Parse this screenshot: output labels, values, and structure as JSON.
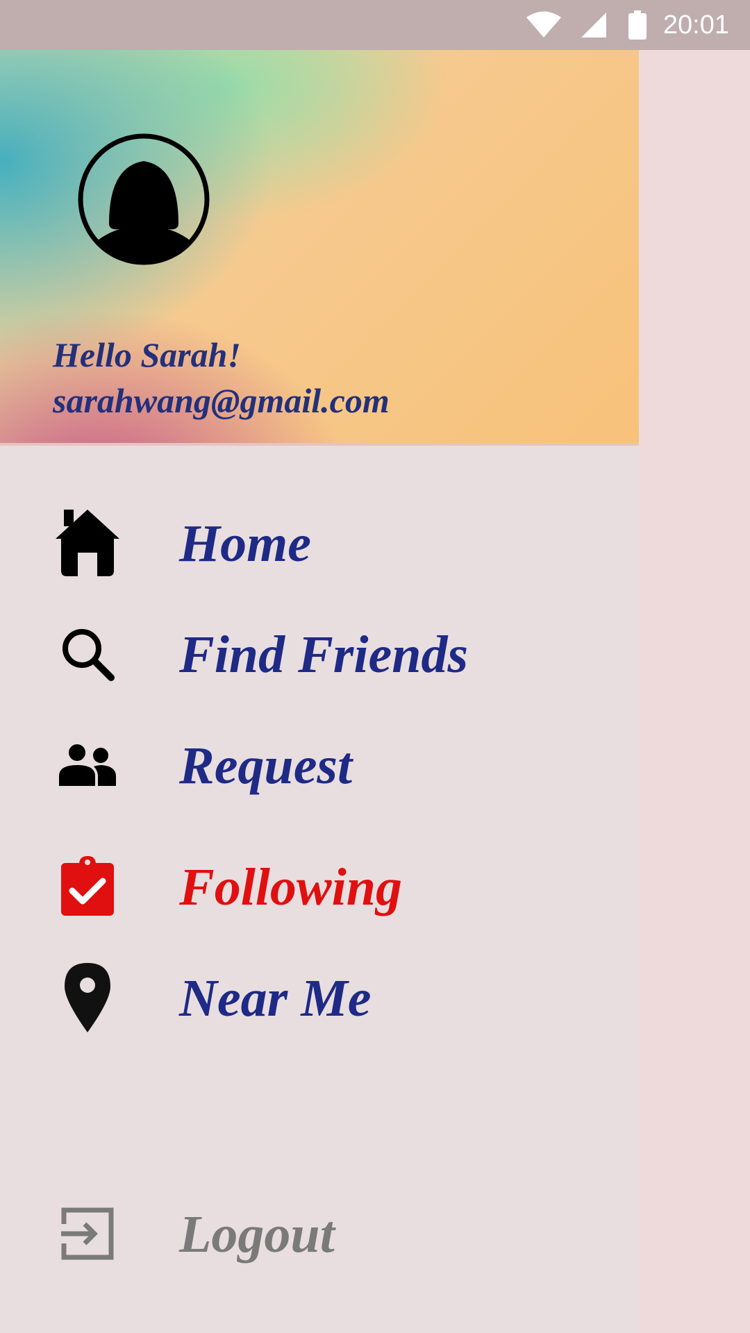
{
  "status_bar": {
    "time": "20:01"
  },
  "header": {
    "greeting": "Hello Sarah!",
    "email": "sarahwang@gmail.com"
  },
  "menu": {
    "items": [
      {
        "label": "Home",
        "icon": "home-icon"
      },
      {
        "label": "Find Friends",
        "icon": "search-icon"
      },
      {
        "label": "Request",
        "icon": "people-icon"
      },
      {
        "label": "Following",
        "icon": "clipboard-check-icon",
        "active": true
      },
      {
        "label": "Near Me",
        "icon": "location-pin-icon"
      }
    ],
    "logout": {
      "label": "Logout",
      "icon": "exit-icon"
    }
  },
  "colors": {
    "menu_text": "#1e2a86",
    "active_text": "#e01010",
    "logout_text": "#7a7a7a",
    "status_bar": "#c0adad",
    "drawer_bg": "#e9dedf"
  }
}
